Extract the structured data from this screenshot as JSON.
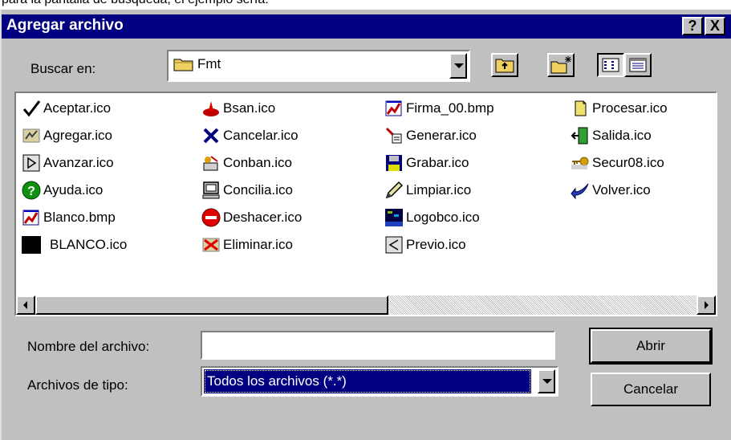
{
  "background_caption": "para la pantalla de búsqueda, el ejemplo sería:",
  "window": {
    "title": "Agregar archivo",
    "help_button": "?",
    "close_button": "X"
  },
  "look_in": {
    "label": "Buscar en:",
    "value": "Fmt"
  },
  "toolbar": {
    "up_one_level": "up-folder-icon",
    "new_folder": "new-folder-icon",
    "list_view": "list-view-icon",
    "details_view": "details-view-icon"
  },
  "files": [
    {
      "name": "Aceptar.ico",
      "icon": "checkmark-icon"
    },
    {
      "name": "Agregar.ico",
      "icon": "add-icon"
    },
    {
      "name": "Avanzar.ico",
      "icon": "forward-icon"
    },
    {
      "name": "Ayuda.ico",
      "icon": "help-icon"
    },
    {
      "name": "Blanco.bmp",
      "icon": "bitmap-icon"
    },
    {
      "name": "BLANCO.ico",
      "icon": "black-square-icon"
    },
    {
      "name": "Bsan.ico",
      "icon": "bsan-icon"
    },
    {
      "name": "Cancelar.ico",
      "icon": "cancel-x-icon"
    },
    {
      "name": "Conban.ico",
      "icon": "conban-icon"
    },
    {
      "name": "Concilia.ico",
      "icon": "computer-icon"
    },
    {
      "name": "Deshacer.ico",
      "icon": "stop-icon"
    },
    {
      "name": "Eliminar.ico",
      "icon": "delete-icon"
    },
    {
      "name": "Firma_00.bmp",
      "icon": "bitmap-icon"
    },
    {
      "name": "Generar.ico",
      "icon": "generate-icon"
    },
    {
      "name": "Grabar.ico",
      "icon": "floppy-disk-icon"
    },
    {
      "name": "Limpiar.ico",
      "icon": "pencil-icon"
    },
    {
      "name": "Logobco.ico",
      "icon": "logo-icon"
    },
    {
      "name": "Previo.ico",
      "icon": "preview-icon"
    },
    {
      "name": "Procesar.ico",
      "icon": "document-icon"
    },
    {
      "name": "Salida.ico",
      "icon": "exit-door-icon"
    },
    {
      "name": "Secur08.ico",
      "icon": "key-icon"
    },
    {
      "name": "Volver.ico",
      "icon": "back-arrow-icon"
    }
  ],
  "file_name": {
    "label": "Nombre del archivo:",
    "value": ""
  },
  "file_type": {
    "label": "Archivos de tipo:",
    "value": "Todos los archivos (*.*)"
  },
  "buttons": {
    "open": "Abrir",
    "cancel": "Cancelar"
  },
  "colors": {
    "title_bar": "#000080",
    "dialog_face": "#c0c0c0",
    "selection": "#000080"
  }
}
